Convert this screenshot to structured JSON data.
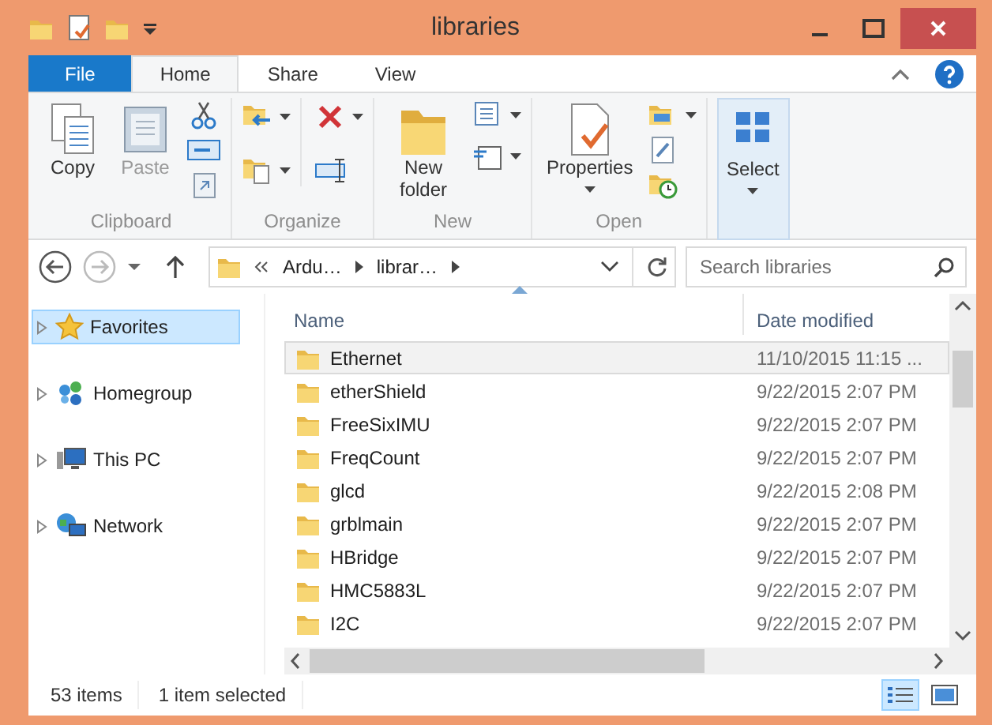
{
  "window": {
    "title": "libraries"
  },
  "ribbon_tabs": [
    {
      "label": "File",
      "kind": "file",
      "selected": false
    },
    {
      "label": "Home",
      "kind": "tab",
      "selected": true
    },
    {
      "label": "Share",
      "kind": "tab",
      "selected": false
    },
    {
      "label": "View",
      "kind": "tab",
      "selected": false
    }
  ],
  "ribbon_groups": [
    {
      "label": "Clipboard",
      "buttons": [
        {
          "label": "Copy",
          "kind": "copy",
          "disabled": false
        },
        {
          "label": "Paste",
          "kind": "paste",
          "disabled": true
        }
      ]
    },
    {
      "label": "Organize"
    },
    {
      "label": "New",
      "buttons": [
        {
          "label": "New folder",
          "kind": "newfolder",
          "disabled": false
        }
      ]
    },
    {
      "label": "Open",
      "buttons": [
        {
          "label": "Properties",
          "kind": "properties",
          "disabled": false
        }
      ]
    },
    {
      "buttons": [
        {
          "label": "Select",
          "kind": "select",
          "disabled": false
        }
      ]
    }
  ],
  "address": {
    "crumbs": [
      "Ardu…",
      "librar…"
    ]
  },
  "search": {
    "placeholder": "Search libraries"
  },
  "nav_pane": [
    {
      "label": "Favorites",
      "kind": "star",
      "selected": true
    },
    {
      "label": "Homegroup",
      "kind": "homegroup",
      "selected": false
    },
    {
      "label": "This PC",
      "kind": "pc",
      "selected": false
    },
    {
      "label": "Network",
      "kind": "network",
      "selected": false
    }
  ],
  "columns": [
    "Name",
    "Date modified"
  ],
  "rows": [
    {
      "name": "Ethernet",
      "date": "11/10/2015 11:15 ...",
      "selected": true
    },
    {
      "name": "etherShield",
      "date": "9/22/2015 2:07 PM",
      "selected": false
    },
    {
      "name": "FreeSixIMU",
      "date": "9/22/2015 2:07 PM",
      "selected": false
    },
    {
      "name": "FreqCount",
      "date": "9/22/2015 2:07 PM",
      "selected": false
    },
    {
      "name": "glcd",
      "date": "9/22/2015 2:08 PM",
      "selected": false
    },
    {
      "name": "grblmain",
      "date": "9/22/2015 2:07 PM",
      "selected": false
    },
    {
      "name": "HBridge",
      "date": "9/22/2015 2:07 PM",
      "selected": false
    },
    {
      "name": "HMC5883L",
      "date": "9/22/2015 2:07 PM",
      "selected": false
    },
    {
      "name": "I2C",
      "date": "9/22/2015 2:07 PM",
      "selected": false
    }
  ],
  "status_bar": {
    "count": "53 items",
    "selection": "1 item selected"
  },
  "view_buttons": [
    {
      "kind": "details",
      "selected": true
    },
    {
      "kind": "tiles",
      "selected": false
    }
  ]
}
